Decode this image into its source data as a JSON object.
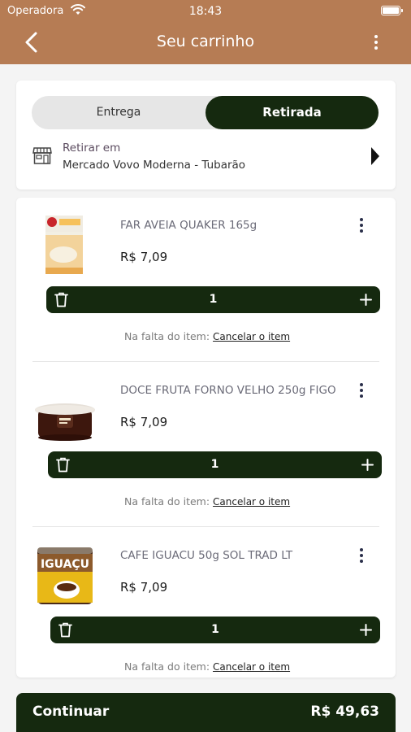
{
  "status_bar": {
    "carrier": "Operadora",
    "time": "18:43"
  },
  "header": {
    "title": "Seu carrinho"
  },
  "delivery": {
    "options": [
      "Entrega",
      "Retirada"
    ],
    "selected": "Retirada",
    "pickup_label": "Retirar em",
    "pickup_store": "Mercado Vovo Moderna - Tubarão"
  },
  "items": [
    {
      "name": "FAR AVEIA QUAKER 165g",
      "price": "R$ 7,09",
      "quantity": "1",
      "missing_label": "Na falta do item:",
      "missing_action": "Cancelar o item"
    },
    {
      "name": "DOCE FRUTA FORNO VELHO 250g FIGO",
      "price": "R$ 7,09",
      "quantity": "1",
      "missing_label": "Na falta do item:",
      "missing_action": "Cancelar o item"
    },
    {
      "name": "CAFE IGUACU 50g SOL TRAD LT",
      "price": "R$ 7,09",
      "quantity": "1",
      "missing_label": "Na falta do item:",
      "missing_action": "Cancelar o item",
      "brand_text": "IGUAÇU"
    }
  ],
  "footer": {
    "continue_label": "Continuar",
    "total": "R$ 49,63"
  },
  "colors": {
    "header_bg": "#b67c54",
    "primary_dark": "#15290f",
    "background": "#f4f4f4"
  },
  "icons": {
    "back": "chevron-left-icon",
    "menu": "more-vertical-icon",
    "store": "store-icon",
    "arrow": "caret-right-icon",
    "trash": "trash-icon",
    "plus": "plus-icon"
  }
}
